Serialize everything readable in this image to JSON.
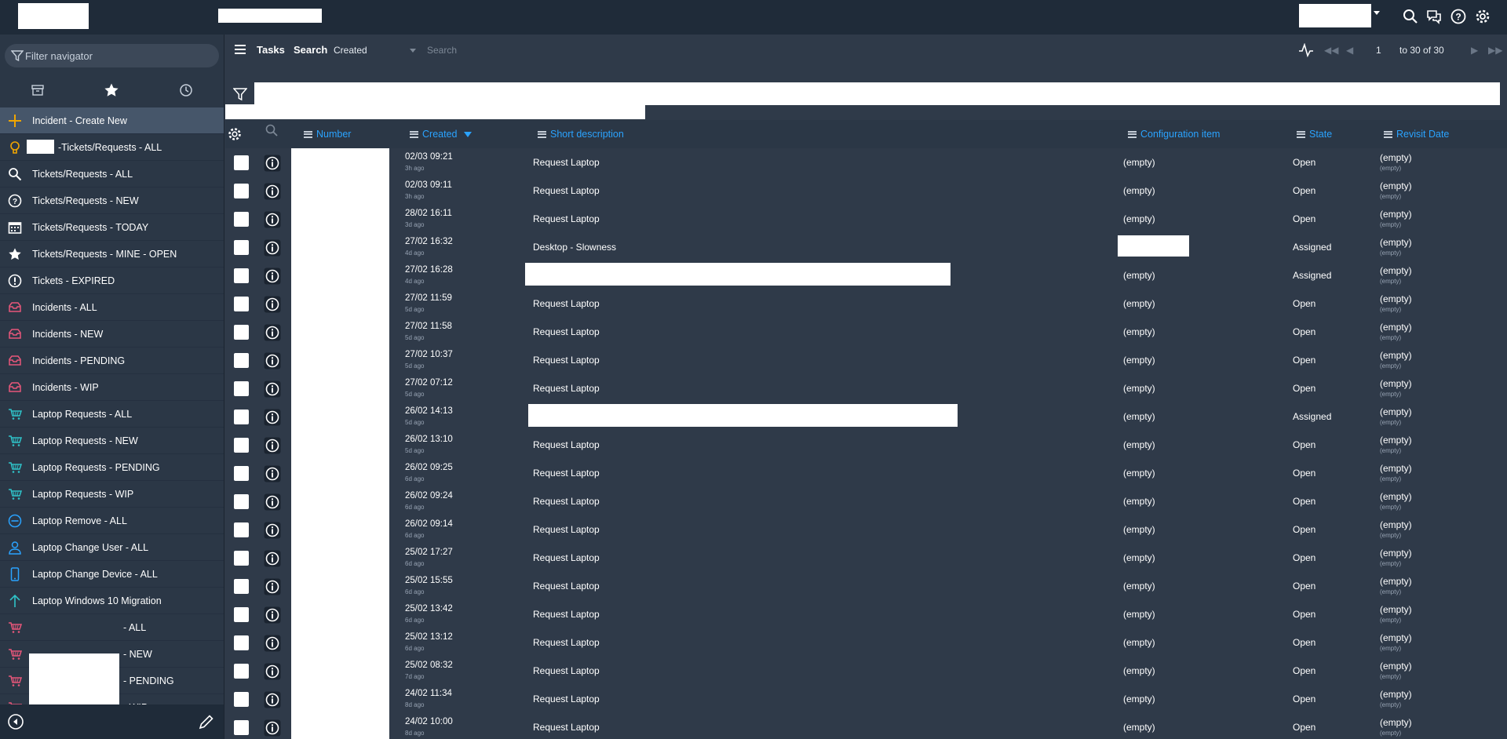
{
  "header": {
    "icons": [
      "search-icon",
      "chat-icon",
      "help-icon",
      "gear-icon"
    ]
  },
  "nav": {
    "filter_placeholder": "Filter navigator",
    "tabs": [
      "archive-icon",
      "star-icon",
      "history-icon"
    ],
    "items": [
      {
        "label": "Incident - Create New",
        "icon": "plus-icon",
        "color": "#f0a500",
        "active": true
      },
      {
        "label": "-Tickets/Requests - ALL",
        "icon": "bulb-icon",
        "color": "#f0a500"
      },
      {
        "label": "Tickets/Requests - ALL",
        "icon": "search-icon",
        "color": "#ffffff"
      },
      {
        "label": "Tickets/Requests - NEW",
        "icon": "question-icon",
        "color": "#ffffff"
      },
      {
        "label": "Tickets/Requests - TODAY",
        "icon": "calendar-icon",
        "color": "#ffffff"
      },
      {
        "label": "Tickets/Requests - MINE - OPEN",
        "icon": "star-icon",
        "color": "#ffffff"
      },
      {
        "label": "Tickets - EXPIRED",
        "icon": "exclamation-icon",
        "color": "#ffffff"
      },
      {
        "label": "Incidents - ALL",
        "icon": "inbox-icon",
        "color": "#e8577a"
      },
      {
        "label": "Incidents - NEW",
        "icon": "inbox-icon",
        "color": "#e8577a"
      },
      {
        "label": "Incidents - PENDING",
        "icon": "inbox-icon",
        "color": "#e8577a"
      },
      {
        "label": "Incidents - WIP",
        "icon": "inbox-icon",
        "color": "#e8577a"
      },
      {
        "label": "Laptop Requests - ALL",
        "icon": "cart-icon",
        "color": "#2fc3c9"
      },
      {
        "label": "Laptop Requests - NEW",
        "icon": "cart-icon",
        "color": "#2fc3c9"
      },
      {
        "label": "Laptop Requests - PENDING",
        "icon": "cart-icon",
        "color": "#2fc3c9"
      },
      {
        "label": "Laptop Requests - WIP",
        "icon": "cart-icon",
        "color": "#2fc3c9"
      },
      {
        "label": "Laptop Remove - ALL",
        "icon": "minus-circle-icon",
        "color": "#2aa3ff"
      },
      {
        "label": "Laptop Change User - ALL",
        "icon": "user-icon",
        "color": "#2aa3ff"
      },
      {
        "label": "Laptop Change Device - ALL",
        "icon": "phone-icon",
        "color": "#2aa3ff"
      },
      {
        "label": "Laptop Windows 10 Migration",
        "icon": "arrow-up-icon",
        "color": "#2fc3c9"
      },
      {
        "label": "- ALL",
        "icon": "cart-icon",
        "color": "#e8577a"
      },
      {
        "label": "- NEW",
        "icon": "cart-icon",
        "color": "#e8577a"
      },
      {
        "label": "- PENDING",
        "icon": "cart-icon",
        "color": "#e8577a"
      },
      {
        "label": "- WIP",
        "icon": "cart-icon",
        "color": "#e8577a"
      }
    ]
  },
  "list": {
    "title": "Tasks",
    "search_label": "Search",
    "search_field": "Created",
    "search_placeholder": "Search",
    "pager": {
      "page": "1",
      "range": "to 30 of 30"
    }
  },
  "table": {
    "columns": {
      "number": "Number",
      "created": "Created",
      "short_description": "Short description",
      "configuration_item": "Configuration item",
      "state": "State",
      "revisit_date": "Revisit Date"
    },
    "rows": [
      {
        "created": "02/03 09:21",
        "ago": "3h ago",
        "desc": "Request Laptop",
        "ci": "(empty)",
        "state": "Open",
        "revisit": "(empty)",
        "revisit_sub": "(empty)"
      },
      {
        "created": "02/03 09:11",
        "ago": "3h ago",
        "desc": "Request Laptop",
        "ci": "(empty)",
        "state": "Open",
        "revisit": "(empty)",
        "revisit_sub": "(empty)"
      },
      {
        "created": "28/02 16:11",
        "ago": "3d ago",
        "desc": "Request Laptop",
        "ci": "(empty)",
        "state": "Open",
        "revisit": "(empty)",
        "revisit_sub": "(empty)"
      },
      {
        "created": "27/02 16:32",
        "ago": "4d ago",
        "desc": "Desktop - Slowness",
        "ci": "",
        "ci_redacted": true,
        "state": "Assigned",
        "revisit": "(empty)",
        "revisit_sub": "(empty)"
      },
      {
        "created": "27/02 16:28",
        "ago": "4d ago",
        "desc": "",
        "desc_redacted": "a",
        "ci": "(empty)",
        "state": "Assigned",
        "revisit": "(empty)",
        "revisit_sub": "(empty)"
      },
      {
        "created": "27/02 11:59",
        "ago": "5d ago",
        "desc": "Request Laptop",
        "ci": "(empty)",
        "state": "Open",
        "revisit": "(empty)",
        "revisit_sub": "(empty)"
      },
      {
        "created": "27/02 11:58",
        "ago": "5d ago",
        "desc": "Request Laptop",
        "ci": "(empty)",
        "state": "Open",
        "revisit": "(empty)",
        "revisit_sub": "(empty)"
      },
      {
        "created": "27/02 10:37",
        "ago": "5d ago",
        "desc": "Request Laptop",
        "ci": "(empty)",
        "state": "Open",
        "revisit": "(empty)",
        "revisit_sub": "(empty)"
      },
      {
        "created": "27/02 07:12",
        "ago": "5d ago",
        "desc": "Request Laptop",
        "ci": "(empty)",
        "state": "Open",
        "revisit": "(empty)",
        "revisit_sub": "(empty)"
      },
      {
        "created": "26/02 14:13",
        "ago": "5d ago",
        "desc": "",
        "desc_redacted": "b",
        "ci": "(empty)",
        "state": "Assigned",
        "revisit": "(empty)",
        "revisit_sub": "(empty)"
      },
      {
        "created": "26/02 13:10",
        "ago": "5d ago",
        "desc": "Request Laptop",
        "ci": "(empty)",
        "state": "Open",
        "revisit": "(empty)",
        "revisit_sub": "(empty)"
      },
      {
        "created": "26/02 09:25",
        "ago": "6d ago",
        "desc": "Request Laptop",
        "ci": "(empty)",
        "state": "Open",
        "revisit": "(empty)",
        "revisit_sub": "(empty)"
      },
      {
        "created": "26/02 09:24",
        "ago": "6d ago",
        "desc": "Request Laptop",
        "ci": "(empty)",
        "state": "Open",
        "revisit": "(empty)",
        "revisit_sub": "(empty)"
      },
      {
        "created": "26/02 09:14",
        "ago": "6d ago",
        "desc": "Request Laptop",
        "ci": "(empty)",
        "state": "Open",
        "revisit": "(empty)",
        "revisit_sub": "(empty)"
      },
      {
        "created": "25/02 17:27",
        "ago": "6d ago",
        "desc": "Request Laptop",
        "ci": "(empty)",
        "state": "Open",
        "revisit": "(empty)",
        "revisit_sub": "(empty)"
      },
      {
        "created": "25/02 15:55",
        "ago": "6d ago",
        "desc": "Request Laptop",
        "ci": "(empty)",
        "state": "Open",
        "revisit": "(empty)",
        "revisit_sub": "(empty)"
      },
      {
        "created": "25/02 13:42",
        "ago": "6d ago",
        "desc": "Request Laptop",
        "ci": "(empty)",
        "state": "Open",
        "revisit": "(empty)",
        "revisit_sub": "(empty)"
      },
      {
        "created": "25/02 13:12",
        "ago": "6d ago",
        "desc": "Request Laptop",
        "ci": "(empty)",
        "state": "Open",
        "revisit": "(empty)",
        "revisit_sub": "(empty)"
      },
      {
        "created": "25/02 08:32",
        "ago": "7d ago",
        "desc": "Request Laptop",
        "ci": "(empty)",
        "state": "Open",
        "revisit": "(empty)",
        "revisit_sub": "(empty)"
      },
      {
        "created": "24/02 11:34",
        "ago": "8d ago",
        "desc": "Request Laptop",
        "ci": "(empty)",
        "state": "Open",
        "revisit": "(empty)",
        "revisit_sub": "(empty)"
      },
      {
        "created": "24/02 10:00",
        "ago": "8d ago",
        "desc": "Request Laptop",
        "ci": "(empty)",
        "state": "Open",
        "revisit": "(empty)",
        "revisit_sub": "(empty)"
      }
    ]
  },
  "colors": {
    "background": "#2f3a49",
    "header": "#1f2b39",
    "accent": "#2aa3ff"
  }
}
